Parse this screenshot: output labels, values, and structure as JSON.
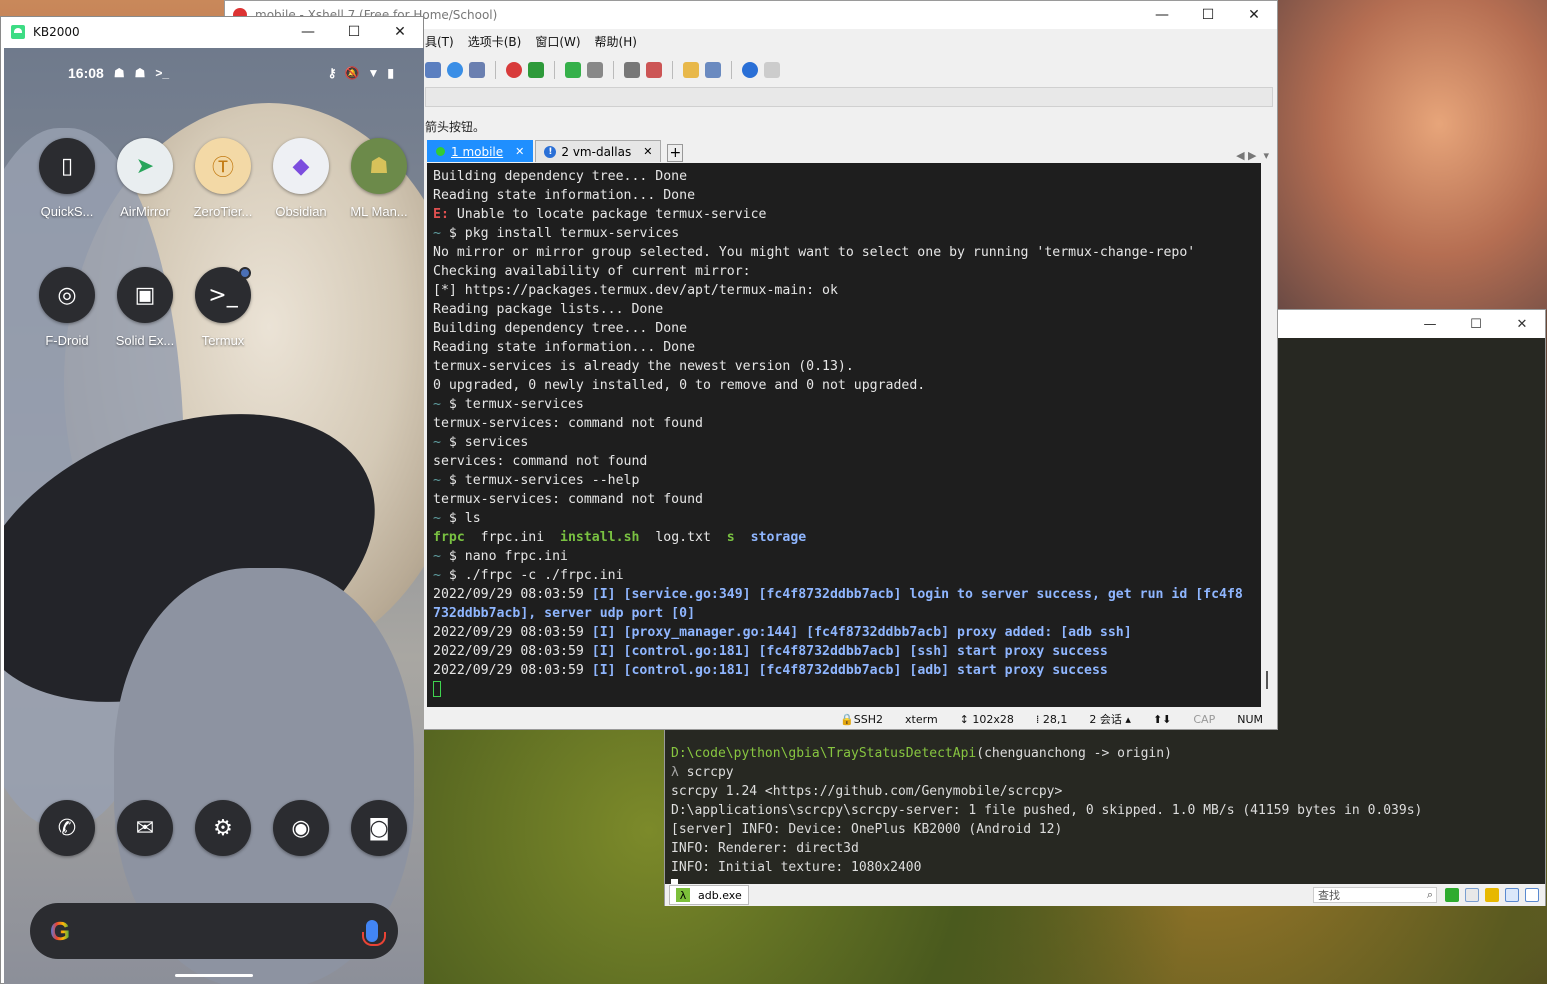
{
  "phone_window": {
    "title": "KB2000",
    "status": {
      "time": "16:08"
    },
    "apps": [
      {
        "label": "QuickS...",
        "icon": "quickswitch-icon",
        "glyph": "▯"
      },
      {
        "label": "AirMirror",
        "icon": "airmirror-icon",
        "glyph": "➤"
      },
      {
        "label": "ZeroTier...",
        "icon": "zerotier-icon",
        "glyph": "Ⓣ"
      },
      {
        "label": "Obsidian",
        "icon": "obsidian-icon",
        "glyph": "◆"
      },
      {
        "label": "ML Man...",
        "icon": "android-icon",
        "glyph": "☗"
      },
      {
        "label": "F-Droid",
        "icon": "fdroid-icon",
        "glyph": "◎"
      },
      {
        "label": "Solid Ex...",
        "icon": "solid-explorer-icon",
        "glyph": "▣"
      },
      {
        "label": "Termux",
        "icon": "termux-icon",
        "glyph": ">_"
      }
    ],
    "dock": [
      {
        "icon": "phone-icon",
        "glyph": "✆"
      },
      {
        "icon": "messages-icon",
        "glyph": "✉"
      },
      {
        "icon": "settings-icon",
        "glyph": "⚙"
      },
      {
        "icon": "chrome-icon",
        "glyph": "◉"
      },
      {
        "icon": "camera-icon",
        "glyph": "◙"
      }
    ],
    "search_logo": "G"
  },
  "xshell": {
    "title": "mobile - Xshell 7 (Free for Home/School)",
    "menu": [
      "具(T)",
      "选项卡(B)",
      "窗口(W)",
      "帮助(H)"
    ],
    "hint": "箭头按钮。",
    "tabs": [
      {
        "label": "1 mobile",
        "active": true
      },
      {
        "label": "2 vm-dallas",
        "active": false
      }
    ],
    "add_tab": "+",
    "status": {
      "protocol": "SSH2",
      "term": "xterm",
      "size": "102x28",
      "pos": "28,1",
      "sessions": "2 会话",
      "cap": "CAP",
      "num": "NUM"
    }
  },
  "terminal": {
    "lines": [
      [
        {
          "t": "Building dependency tree... Done",
          "c": ""
        }
      ],
      [
        {
          "t": "Reading state information... Done",
          "c": ""
        }
      ],
      [
        {
          "t": "E:",
          "c": "err"
        },
        {
          "t": " Unable to locate package termux-service",
          "c": ""
        }
      ],
      [
        {
          "t": "~ ",
          "c": "prompt"
        },
        {
          "t": "$ pkg install termux-services",
          "c": ""
        }
      ],
      [
        {
          "t": "No mirror or mirror group selected. You might want to select one by running 'termux-change-repo'",
          "c": ""
        }
      ],
      [
        {
          "t": "Checking availability of current mirror:",
          "c": ""
        }
      ],
      [
        {
          "t": "[*] https://packages.termux.dev/apt/termux-main: ok",
          "c": ""
        }
      ],
      [
        {
          "t": "Reading package lists... Done",
          "c": ""
        }
      ],
      [
        {
          "t": "Building dependency tree... Done",
          "c": ""
        }
      ],
      [
        {
          "t": "Reading state information... Done",
          "c": ""
        }
      ],
      [
        {
          "t": "termux-services is already the newest version (0.13).",
          "c": ""
        }
      ],
      [
        {
          "t": "0 upgraded, 0 newly installed, 0 to remove and 0 not upgraded.",
          "c": ""
        }
      ],
      [
        {
          "t": "~ ",
          "c": "prompt"
        },
        {
          "t": "$ termux-services",
          "c": ""
        }
      ],
      [
        {
          "t": "termux-services: command not found",
          "c": ""
        }
      ],
      [
        {
          "t": "~ ",
          "c": "prompt"
        },
        {
          "t": "$ services",
          "c": ""
        }
      ],
      [
        {
          "t": "services: command not found",
          "c": ""
        }
      ],
      [
        {
          "t": "~ ",
          "c": "prompt"
        },
        {
          "t": "$ termux-services --help",
          "c": ""
        }
      ],
      [
        {
          "t": "termux-services: command not found",
          "c": ""
        }
      ],
      [
        {
          "t": "~ ",
          "c": "prompt"
        },
        {
          "t": "$ ls",
          "c": ""
        }
      ],
      [
        {
          "t": "frpc",
          "c": "green"
        },
        {
          "t": "  frpc.ini  ",
          "c": ""
        },
        {
          "t": "install.sh",
          "c": "green"
        },
        {
          "t": "  log.txt  ",
          "c": ""
        },
        {
          "t": "s",
          "c": "green"
        },
        {
          "t": "  ",
          "c": ""
        },
        {
          "t": "storage",
          "c": "dir"
        }
      ],
      [
        {
          "t": "~ ",
          "c": "prompt"
        },
        {
          "t": "$ nano frpc.ini",
          "c": ""
        }
      ],
      [
        {
          "t": "~ ",
          "c": "prompt"
        },
        {
          "t": "$ ./frpc -c ./frpc.ini",
          "c": ""
        }
      ],
      [
        {
          "t": "2022/09/29 08:03:59 ",
          "c": ""
        },
        {
          "t": "[I] [service.go:349] [fc4f8732ddbb7acb] login to server success, get run id [fc4f8",
          "c": "blue"
        }
      ],
      [
        {
          "t": "732ddbb7acb], server udp port [0]",
          "c": "blue"
        }
      ],
      [
        {
          "t": "2022/09/29 08:03:59 ",
          "c": ""
        },
        {
          "t": "[I] [proxy_manager.go:144] [fc4f8732ddbb7acb] proxy added: [adb ssh]",
          "c": "blue"
        }
      ],
      [
        {
          "t": "2022/09/29 08:03:59 ",
          "c": ""
        },
        {
          "t": "[I] [control.go:181] [fc4f8732ddbb7acb] [ssh] start proxy success",
          "c": "blue"
        }
      ],
      [
        {
          "t": "2022/09/29 08:03:59 ",
          "c": ""
        },
        {
          "t": "[I] [control.go:181] [fc4f8732ddbb7acb] [adb] start proxy success",
          "c": "blue"
        }
      ]
    ]
  },
  "cmder": {
    "lines": [
      [
        {
          "t": "D:\\code\\python\\gbia\\TrayStatusDetectApi",
          "c": "green"
        },
        {
          "t": "(chenguanchong -> origin)",
          "c": ""
        }
      ],
      [
        {
          "t": "λ ",
          "c": "dim"
        },
        {
          "t": "scrcpy",
          "c": ""
        }
      ],
      [
        {
          "t": "scrcpy 1.24 <https://github.com/Genymobile/scrcpy>",
          "c": ""
        }
      ],
      [
        {
          "t": "D:\\applications\\scrcpy\\scrcpy-server: 1 file pushed, 0 skipped. 1.0 MB/s (41159 bytes in 0.039s)",
          "c": ""
        }
      ],
      [
        {
          "t": "[server] INFO: Device: OnePlus KB2000 (Android 12)",
          "c": ""
        }
      ],
      [
        {
          "t": "INFO: Renderer: direct3d",
          "c": ""
        }
      ],
      [
        {
          "t": "INFO: Initial texture: 1080x2400",
          "c": ""
        }
      ]
    ],
    "tab_label": "adb.exe",
    "search_placeholder": "查找"
  }
}
